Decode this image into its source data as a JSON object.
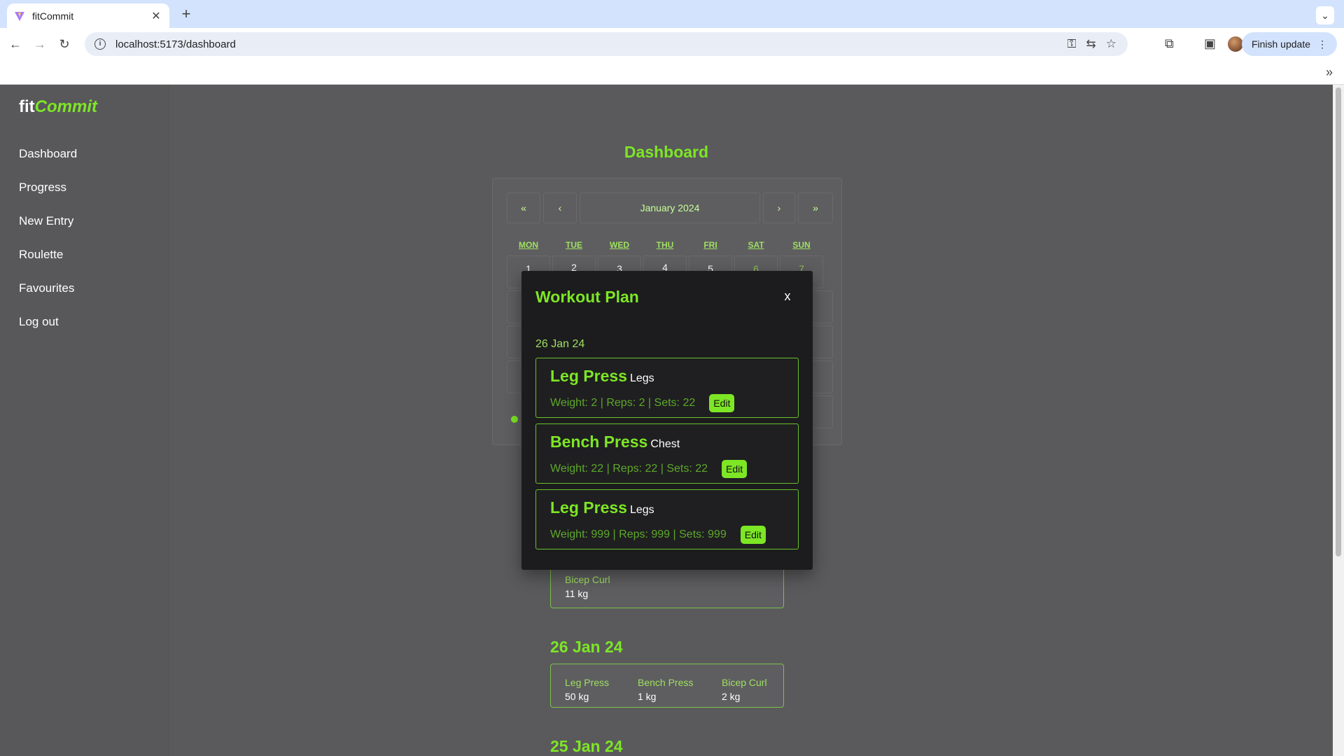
{
  "browser": {
    "tab_title": "fitCommit",
    "url": "localhost:5173/dashboard",
    "finish_update": "Finish update"
  },
  "app": {
    "logo_fit": "fit",
    "logo_commit": "Commit",
    "nav": [
      "Dashboard",
      "Progress",
      "New Entry",
      "Roulette",
      "Favourites",
      "Log out"
    ],
    "page_title": "Dashboard"
  },
  "calendar": {
    "prev_year": "«",
    "prev_month": "‹",
    "month_label": "January 2024",
    "next_month": "›",
    "next_year": "»",
    "weekdays": [
      "MON",
      "TUE",
      "WED",
      "THU",
      "FRI",
      "SAT",
      "SUN"
    ],
    "first_row": [
      "1",
      "2",
      "3",
      "4",
      "5",
      "6",
      "7"
    ]
  },
  "entries": {
    "partial_card": {
      "name": "Bicep Curl",
      "value": "11 kg"
    },
    "day1": {
      "date": "26 Jan 24",
      "items": [
        {
          "name": "Leg Press",
          "value": "50 kg"
        },
        {
          "name": "Bench Press",
          "value": "1 kg"
        },
        {
          "name": "Bicep Curl",
          "value": "2 kg"
        }
      ]
    },
    "day2": {
      "date": "25 Jan 24"
    }
  },
  "modal": {
    "title": "Workout Plan",
    "close": "x",
    "date": "26 Jan 24",
    "edit_label": "Edit",
    "exercises": [
      {
        "name": "Leg Press",
        "muscle": "Legs",
        "detail": "Weight: 2 | Reps: 2 | Sets: 22"
      },
      {
        "name": "Bench Press",
        "muscle": "Chest",
        "detail": "Weight: 22 | Reps: 22 | Sets: 22"
      },
      {
        "name": "Leg Press",
        "muscle": "Legs",
        "detail": "Weight: 999 | Reps: 999 | Sets: 999"
      }
    ]
  },
  "colors": {
    "accent": "#7de625",
    "background": "#5a5a5c",
    "modal_bg": "#1c1c1e"
  }
}
